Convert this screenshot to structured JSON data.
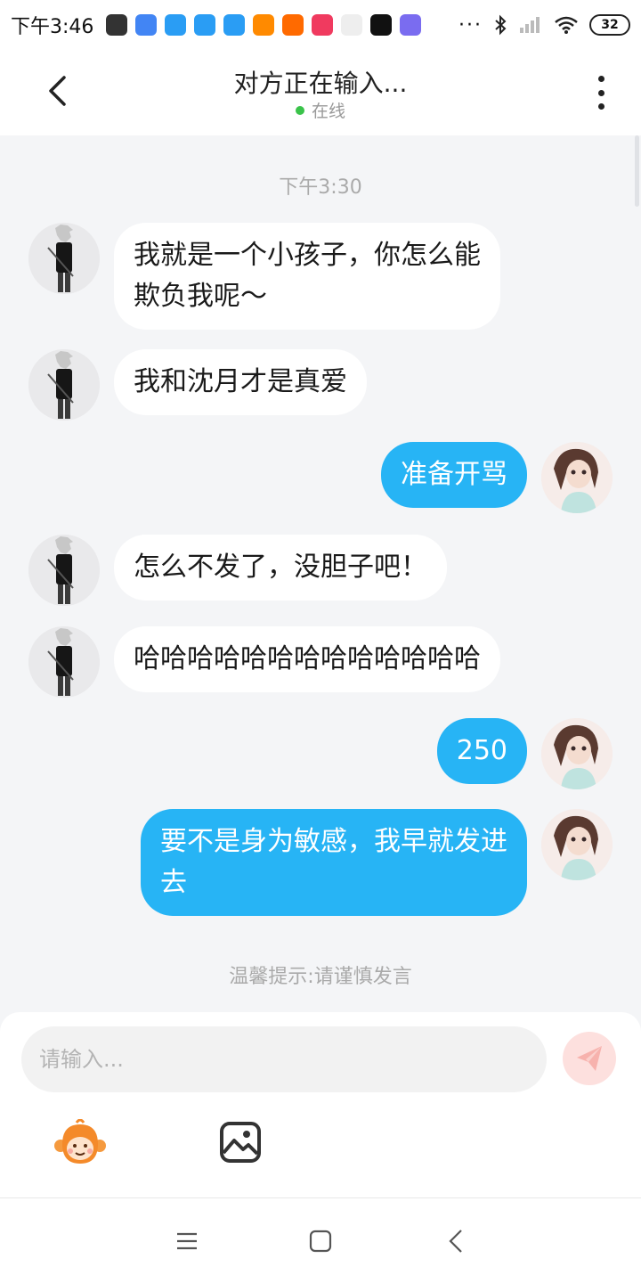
{
  "status_bar": {
    "time": "下午3:46",
    "battery": "32",
    "app_icons": [
      {
        "name": "upload-icon",
        "color": "#333333"
      },
      {
        "name": "play-store-icon",
        "color": "#4285f4"
      },
      {
        "name": "app-blue-icon-1",
        "color": "#2a9df4"
      },
      {
        "name": "app-blue-icon-2",
        "color": "#2a9df4"
      },
      {
        "name": "app-blue-icon-3",
        "color": "#2a9df4"
      },
      {
        "name": "taobao-icon",
        "color": "#ff8a00"
      },
      {
        "name": "app-orange-icon",
        "color": "#ff6a00"
      },
      {
        "name": "douyin-icon",
        "color": "#f03a5f"
      },
      {
        "name": "app-white-icon",
        "color": "#eeeeee"
      },
      {
        "name": "app-green-circle-icon",
        "color": "#111111"
      },
      {
        "name": "app-colorful-icon",
        "color": "#7a6cf0"
      }
    ],
    "overflow": "···"
  },
  "header": {
    "title": "对方正在输入...",
    "status": "在线"
  },
  "chat": {
    "timestamp": "下午3:30",
    "messages": [
      {
        "side": "in",
        "lines": [
          "我就是一个小孩子，你怎么能",
          "欺负我呢～"
        ]
      },
      {
        "side": "in",
        "lines": [
          "我和沈月才是真爱"
        ]
      },
      {
        "side": "out",
        "lines": [
          "准备开骂"
        ]
      },
      {
        "side": "in",
        "lines": [
          "怎么不发了，没胆子吧！"
        ]
      },
      {
        "side": "in",
        "lines": [
          "哈哈哈哈哈哈哈哈哈哈哈哈哈"
        ]
      },
      {
        "side": "out",
        "lines": [
          "250"
        ]
      },
      {
        "side": "out",
        "lines": [
          "要不是身为敏感，我早就发进",
          "去"
        ]
      }
    ],
    "hint": "温馨提示:请谨慎发言"
  },
  "composer": {
    "placeholder": "请输入..."
  },
  "colors": {
    "accent": "#27b4f5",
    "online": "#3ac34a",
    "send_button": "#fde0de"
  }
}
